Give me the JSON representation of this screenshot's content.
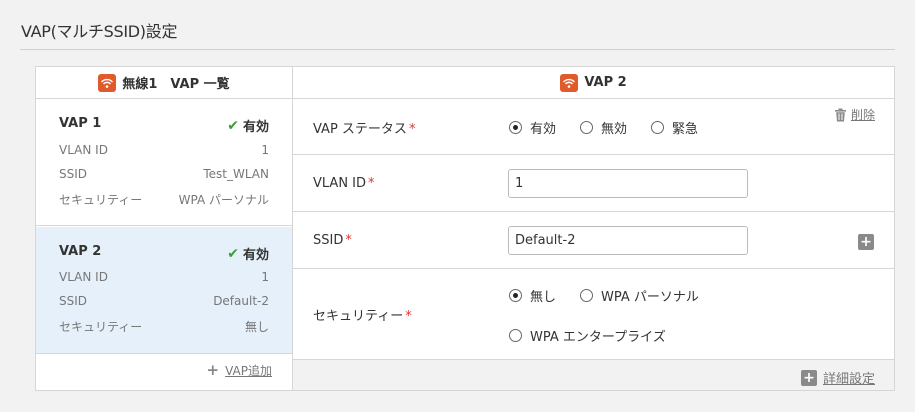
{
  "page": {
    "title": "VAP(マルチSSID)設定"
  },
  "vap_list": {
    "header": "無線1　VAP 一覧",
    "cards": [
      {
        "name": "VAP 1",
        "status": "有効",
        "rows": [
          {
            "label": "VLAN ID",
            "value": "1"
          },
          {
            "label": "SSID",
            "value": "Test_WLAN"
          },
          {
            "label": "セキュリティー",
            "value": "WPA パーソナル"
          }
        ]
      },
      {
        "name": "VAP 2",
        "status": "有効",
        "rows": [
          {
            "label": "VLAN ID",
            "value": "1"
          },
          {
            "label": "SSID",
            "value": "Default-2"
          },
          {
            "label": "セキュリティー",
            "value": "無し"
          }
        ]
      }
    ],
    "add_label": "VAP追加"
  },
  "vap_detail": {
    "header": "VAP 2",
    "delete_label": "削除",
    "status": {
      "label": "VAP ステータス",
      "options": [
        "有効",
        "無効",
        "緊急"
      ],
      "selected": "有効"
    },
    "vlan": {
      "label": "VLAN ID",
      "value": "1"
    },
    "ssid": {
      "label": "SSID",
      "value": "Default-2"
    },
    "security": {
      "label": "セキュリティー",
      "options": [
        "無し",
        "WPA パーソナル",
        "WPA エンタープライズ"
      ],
      "selected": "無し"
    },
    "advanced_label": "詳細設定",
    "required_mark": "*"
  },
  "colors": {
    "accent_orange": "#e05a2b",
    "check_green": "#3a9d3a",
    "selected_bg": "#e6f0fa",
    "required_red": "#dd3333"
  }
}
